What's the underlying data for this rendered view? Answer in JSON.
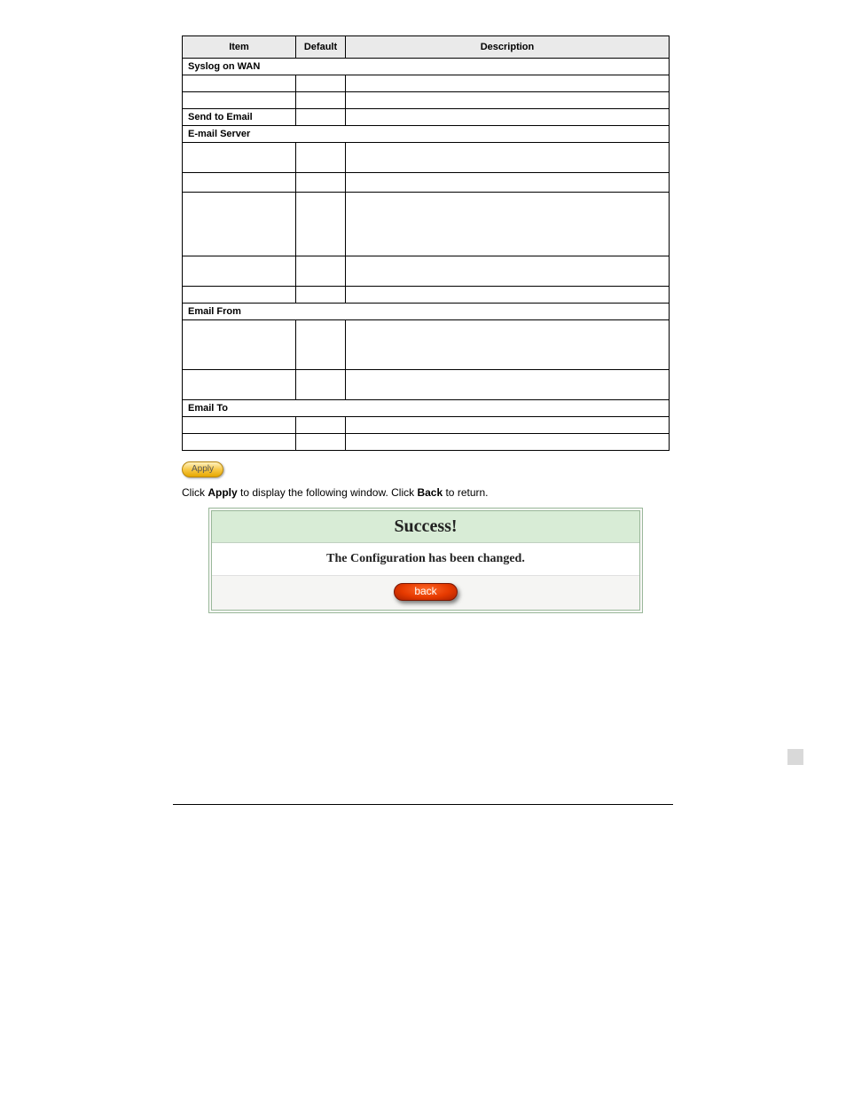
{
  "table": {
    "headers": {
      "item": "Item",
      "default": "Default",
      "description": "Description"
    },
    "sections": {
      "syslog_wan": "Syslog on WAN",
      "send_email": "Send to Email",
      "email_server": "E-mail Server",
      "email_from": "Email From",
      "email_to": "Email To"
    }
  },
  "apply_button": "Apply",
  "apply_back_text_1": "Click ",
  "apply_back_bold_1": "Apply",
  "apply_back_text_2": " to display the following window. Click ",
  "apply_back_bold_2": "Back",
  "apply_back_text_3": " to return.",
  "success": {
    "title": "Success!",
    "message": "The Configuration has been changed.",
    "back": "back"
  }
}
